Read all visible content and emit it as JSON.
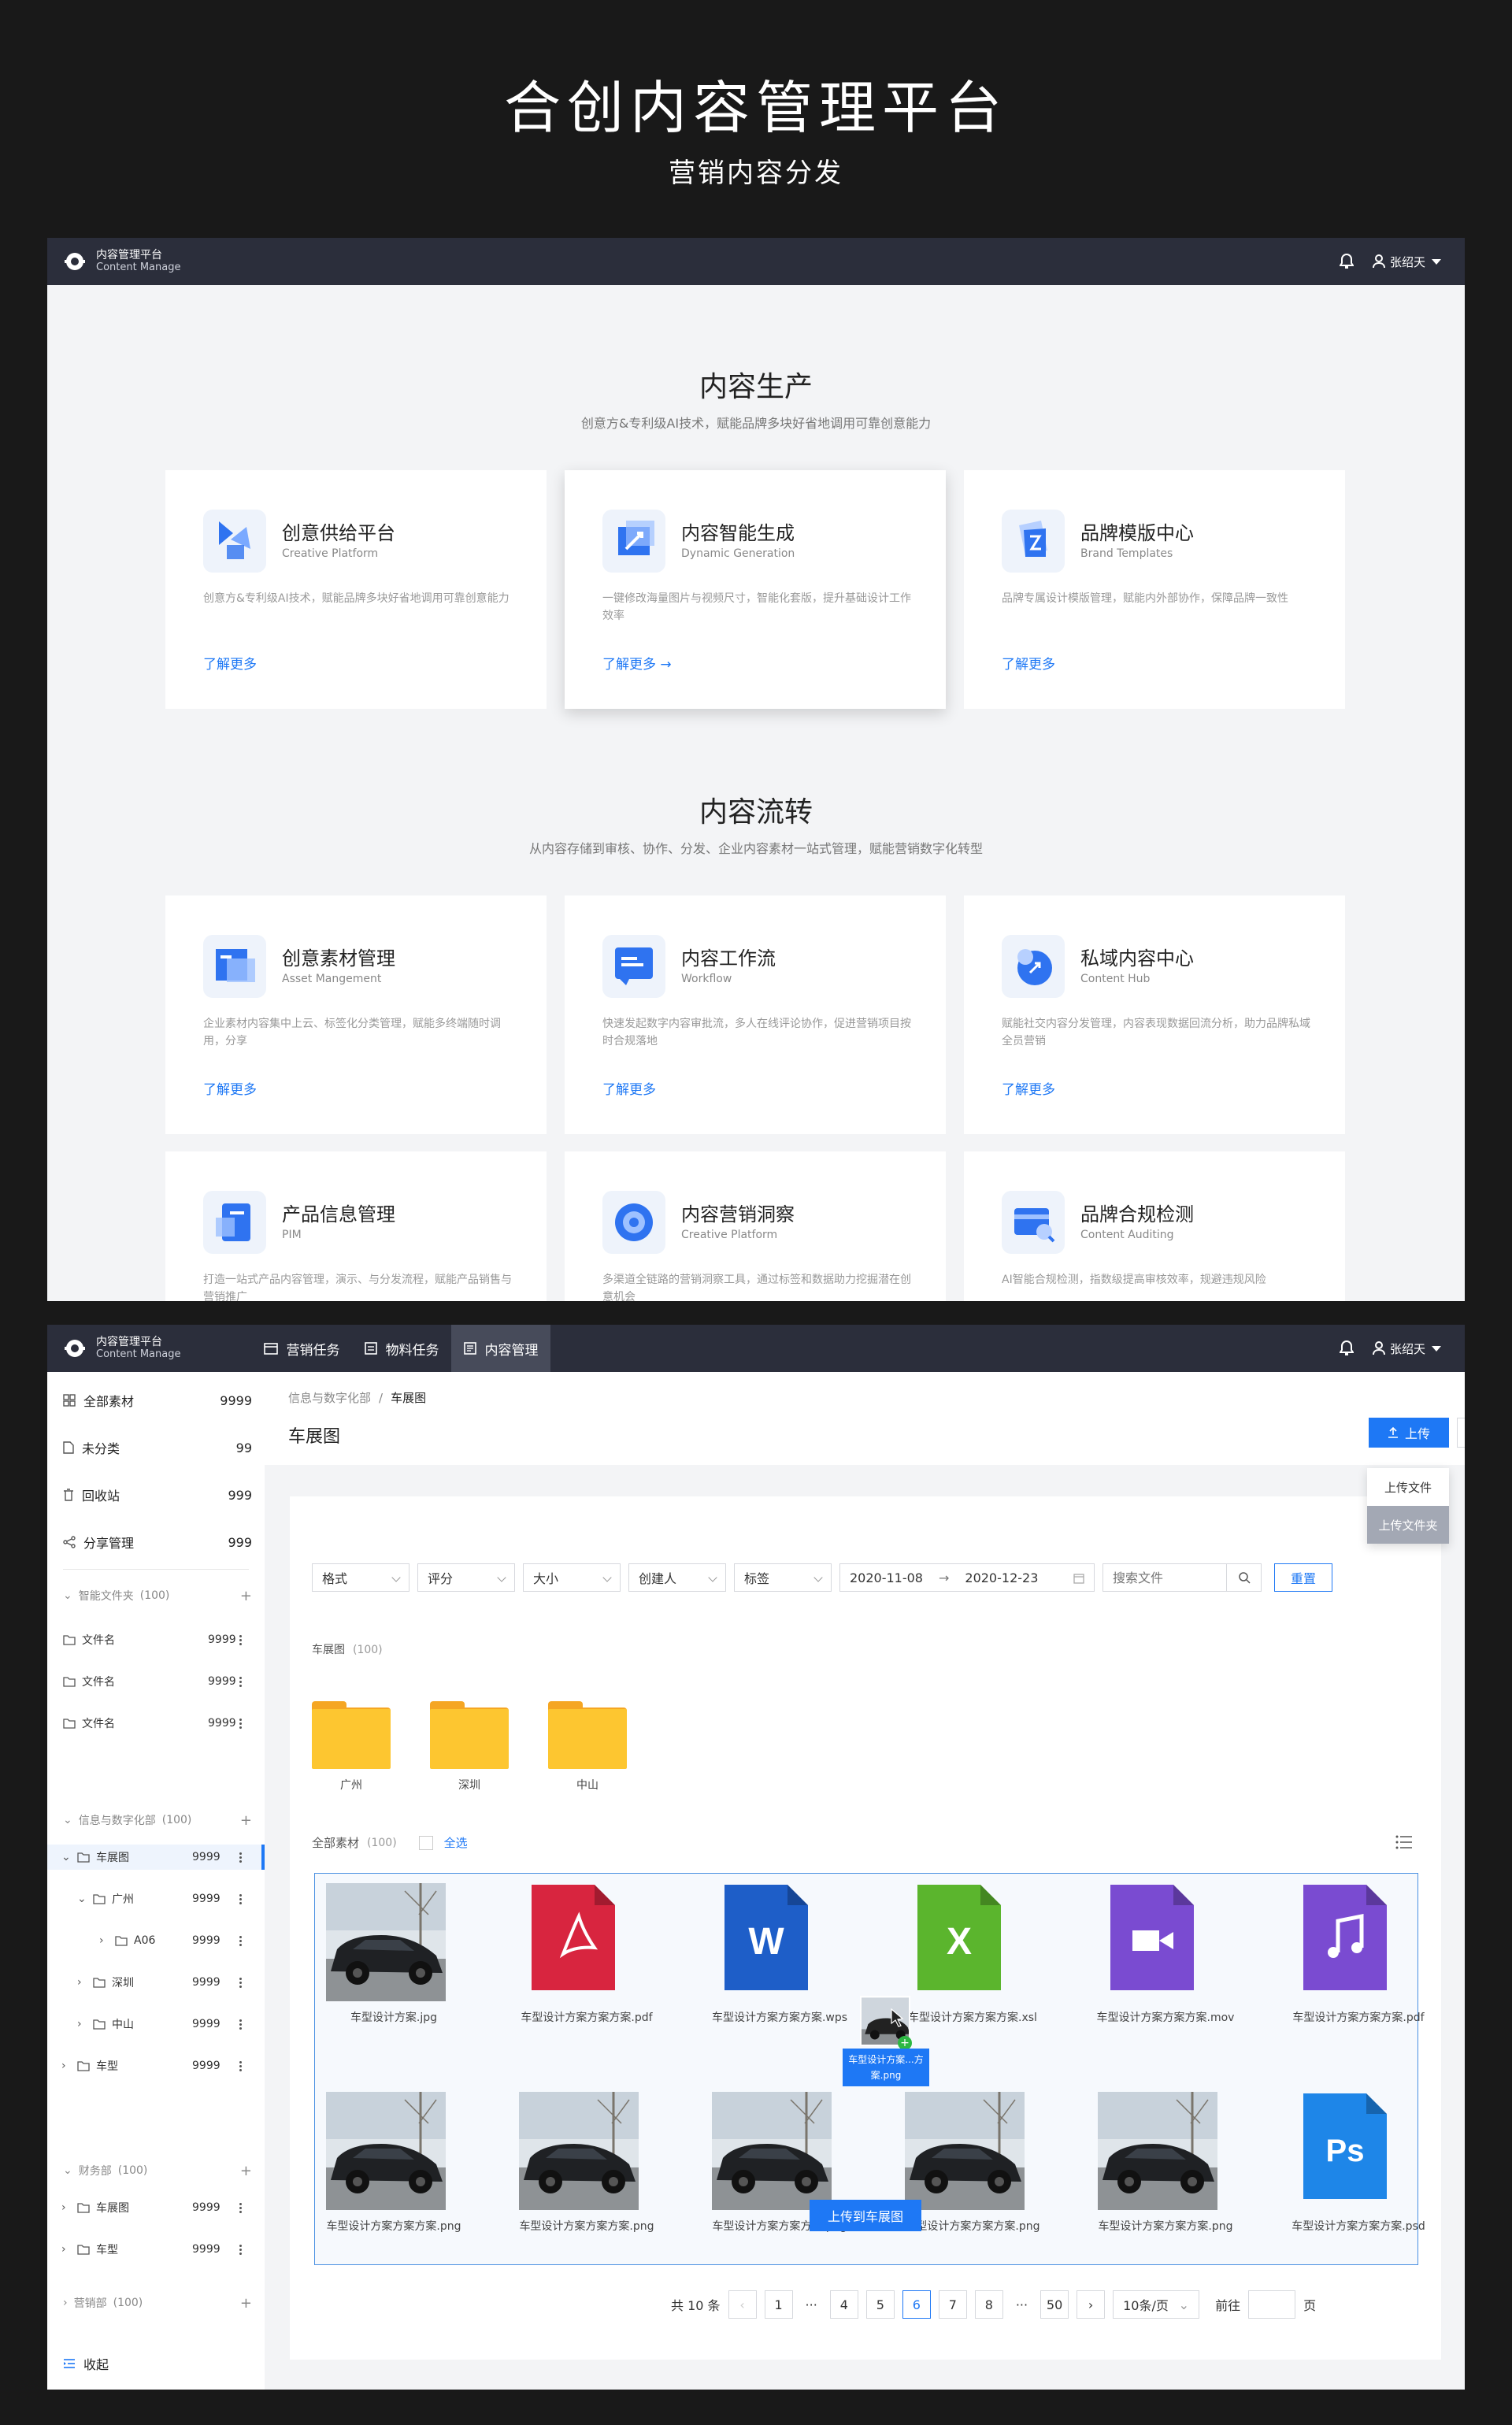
{
  "header": {
    "title": "合创内容管理平台",
    "subtitle": "营销内容分发"
  },
  "app": {
    "name": "内容管理平台",
    "name_en": "Content Manage",
    "user": "张绍天"
  },
  "production": {
    "title": "内容生产",
    "desc": "创意方&专利级AI技术，赋能品牌多块好省地调用可靠创意能力",
    "cards": [
      {
        "name": "创意供给平台",
        "en": "Creative Platform",
        "desc": "创意方&专利级AI技术，赋能品牌多块好省地调用可靠创意能力",
        "link": "了解更多",
        "icon": "creative-platform-icon"
      },
      {
        "name": "内容智能生成",
        "en": "Dynamic Generation",
        "desc": "一键修改海量图片与视频尺寸，智能化套版，提升基础设计工作效率",
        "link": "了解更多 →",
        "icon": "dynamic-generation-icon"
      },
      {
        "name": "品牌模版中心",
        "en": "Brand Templates",
        "desc": "品牌专属设计模版管理，赋能内外部协作，保障品牌一致性",
        "link": "了解更多",
        "icon": "brand-templates-icon"
      }
    ]
  },
  "circulation": {
    "title": "内容流转",
    "desc": "从内容存储到审核、协作、分发、企业内容素材一站式管理，赋能营销数字化转型",
    "cards": [
      {
        "name": "创意素材管理",
        "en": "Asset Mangement",
        "desc": "企业素材内容集中上云、标签化分类管理，赋能多终端随时调用，分享",
        "link": "了解更多",
        "icon": "asset-management-icon"
      },
      {
        "name": "内容工作流",
        "en": "Workflow",
        "desc": "快速发起数字内容审批流，多人在线评论协作，促进营销项目按时合规落地",
        "link": "了解更多",
        "icon": "workflow-icon"
      },
      {
        "name": "私域内容中心",
        "en": "Content Hub",
        "desc": "赋能社交内容分发管理，内容表现数据回流分析，助力品牌私域全员营销",
        "link": "了解更多",
        "icon": "content-hub-icon"
      },
      {
        "name": "产品信息管理",
        "en": "PIM",
        "desc": "打造一站式产品内容管理，演示、与分发流程，赋能产品销售与营销推广",
        "link": "",
        "icon": "pim-icon"
      },
      {
        "name": "内容营销洞察",
        "en": "Creative Platform",
        "desc": "多渠道全链路的营销洞察工具，通过标签和数据助力挖掘潜在创意机会",
        "link": "",
        "icon": "marketing-insight-icon"
      },
      {
        "name": "品牌合规检测",
        "en": "Content Auditing",
        "desc": "AI智能合规检测，指数级提高审核效率，规避违规风险",
        "link": "",
        "icon": "content-auditing-icon"
      }
    ]
  },
  "nav": [
    "营销任务",
    "物料任务",
    "内容管理"
  ],
  "sidebar": {
    "top": [
      {
        "label": "全部素材",
        "count": "9999"
      },
      {
        "label": "未分类",
        "count": "99"
      },
      {
        "label": "回收站",
        "count": "999"
      },
      {
        "label": "分享管理",
        "count": "999"
      }
    ],
    "smart": {
      "label": "智能文件夹",
      "count": "(100)",
      "files": [
        {
          "label": "文件名",
          "count": "9999"
        },
        {
          "label": "文件名",
          "count": "9999"
        },
        {
          "label": "文件名",
          "count": "9999"
        }
      ]
    },
    "dept1": {
      "label": "信息与数字化部",
      "count": "(100)"
    },
    "tree": [
      {
        "label": "车展图",
        "count": "9999"
      },
      {
        "label": "广州",
        "count": "9999"
      },
      {
        "label": "A06",
        "count": "9999"
      },
      {
        "label": "深圳",
        "count": "9999"
      },
      {
        "label": "中山",
        "count": "9999"
      },
      {
        "label": "车型",
        "count": "9999"
      }
    ],
    "dept2": {
      "label": "财务部",
      "count": "(100)"
    },
    "tree2": [
      {
        "label": "车展图",
        "count": "9999"
      },
      {
        "label": "车型",
        "count": "9999"
      }
    ],
    "dept3": {
      "label": "营销部",
      "count": "(100)"
    },
    "collapse": "收起"
  },
  "main": {
    "breadcrumb": [
      "信息与数字化部",
      "车展图"
    ],
    "page_title": "车展图",
    "upload": "上传",
    "upload_menu": [
      "上传文件",
      "上传文件夹"
    ],
    "filters": [
      "格式",
      "评分",
      "大小",
      "创建人",
      "标签"
    ],
    "date_start": "2020-11-08",
    "date_end": "2020-12-23",
    "search_placeholder": "搜索文件",
    "reset": "重置",
    "folders_label": "车展图",
    "folders_count": "(100)",
    "folders": [
      "广州",
      "深圳",
      "中山"
    ],
    "all_label": "全部素材",
    "all_count": "(100)",
    "select_all": "全选",
    "files": [
      {
        "name": "车型设计方案.jpg",
        "type": "image"
      },
      {
        "name": "车型设计方案方案方案.pdf",
        "type": "pdf"
      },
      {
        "name": "车型设计方案方案方案.wps",
        "type": "word"
      },
      {
        "name": "车型设计方案方案方案.xsl",
        "type": "excel"
      },
      {
        "name": "车型设计方案方案方案.mov",
        "type": "video"
      },
      {
        "name": "车型设计方案方案方案.pdf",
        "type": "music"
      },
      {
        "name": "车型设计方案方案方案.png",
        "type": "image"
      },
      {
        "name": "车型设计方案方案方案.png",
        "type": "image"
      },
      {
        "name": "车型设计方案方案方案.png",
        "type": "image"
      },
      {
        "name": "车型设计方案方案方案.png",
        "type": "image"
      },
      {
        "name": "车型设计方案方案方案.png",
        "type": "image"
      },
      {
        "name": "车型设计方案方案方案.psd",
        "type": "ps"
      }
    ],
    "drag_label": "车型设计方案...方案.png",
    "drop_hint": "上传到车展图",
    "pager": {
      "total": "共 10 条",
      "pages": [
        "1",
        "···",
        "4",
        "5",
        "6",
        "7",
        "8",
        "···",
        "50"
      ],
      "current": "6",
      "size": "10条/页",
      "goto": "前往",
      "unit": "页"
    }
  },
  "colors": {
    "accent": "#1e78f5",
    "topbar": "#2b2e3b",
    "folder": "#fdc630"
  }
}
